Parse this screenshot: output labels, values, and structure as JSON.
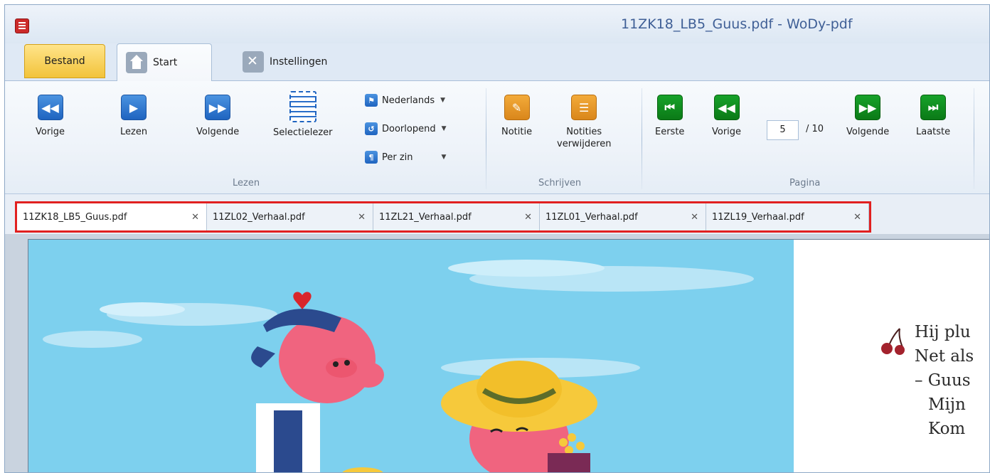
{
  "window": {
    "title": "11ZK18_LB5_Guus.pdf - WoDy-pdf"
  },
  "ribbon_tabs": [
    {
      "label": "Bestand"
    },
    {
      "label": "Start"
    },
    {
      "label": "Instellingen"
    }
  ],
  "ribbon": {
    "lezen": {
      "group_label": "Lezen",
      "vorige": "Vorige",
      "lezen": "Lezen",
      "volgende": "Volgende",
      "selectielezer": "Selectielezer",
      "language": "Nederlands",
      "mode": "Doorlopend",
      "unit": "Per zin"
    },
    "schrijven": {
      "group_label": "Schrijven",
      "notitie": "Notitie",
      "notities_line1": "Notities",
      "notities_line2": "verwijderen"
    },
    "pagina": {
      "group_label": "Pagina",
      "eerste": "Eerste",
      "vorige": "Vorige",
      "current_page": "5",
      "total": "/ 10",
      "volgende": "Volgende",
      "laatste": "Laatste"
    }
  },
  "document_tabs": [
    {
      "label": "11ZK18_LB5_Guus.pdf",
      "active": true
    },
    {
      "label": "11ZL02_Verhaal.pdf",
      "active": false
    },
    {
      "label": "11ZL21_Verhaal.pdf",
      "active": false
    },
    {
      "label": "11ZL01_Verhaal.pdf",
      "active": false
    },
    {
      "label": "11ZL19_Verhaal.pdf",
      "active": false
    }
  ],
  "document": {
    "lines": [
      "Hij plu",
      "Net als",
      "– Guus",
      "Mijn",
      "Kom"
    ]
  },
  "colors": {
    "accent_blue": "#1f64c0",
    "orange": "#d9861b",
    "green": "#0b7a17",
    "tab_highlight": "#e12020",
    "sky": "#7dd0ee"
  }
}
